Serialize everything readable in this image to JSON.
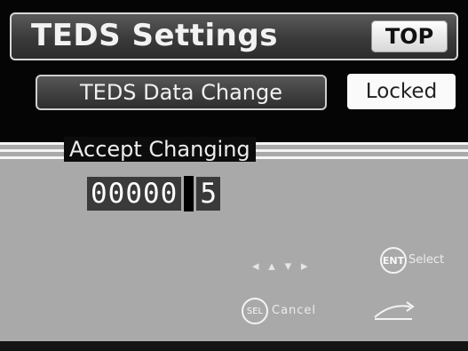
{
  "header": {
    "title": "TEDS Settings",
    "top_button": "TOP"
  },
  "data_change": {
    "button_label": "TEDS Data Change",
    "status": "Locked"
  },
  "accept": {
    "label": "Accept Changing"
  },
  "counter": {
    "digits": "00000",
    "last_digit": "5"
  },
  "hints": {
    "ent_icon_label": "ENT",
    "ent_text": "Select",
    "sel_icon_label": "SEL",
    "sel_text": "Cancel"
  },
  "colors": {
    "background": "#000000",
    "panel": "#a9a9a9",
    "highlight": "#ffffff"
  }
}
